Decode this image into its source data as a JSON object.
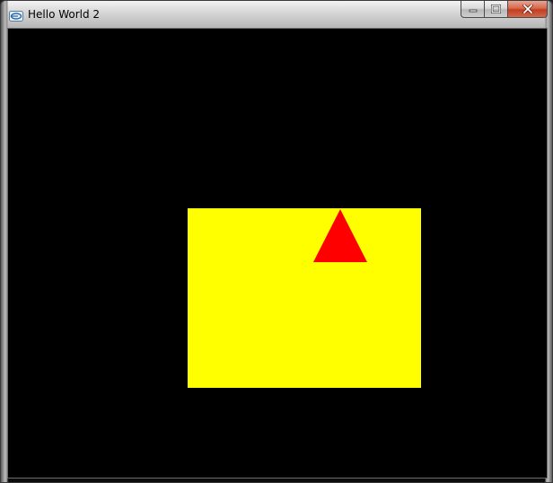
{
  "window": {
    "title": "Hello World 2",
    "caption_buttons": [
      {
        "name": "minimize",
        "icon": "minimize-icon"
      },
      {
        "name": "maximize",
        "icon": "maximize-icon"
      },
      {
        "name": "close",
        "icon": "close-icon"
      }
    ]
  },
  "scene": {
    "background_color": "#000000",
    "rectangle_color": "#ffff00",
    "triangle_color": "#ff0000"
  },
  "colors": {
    "close_button": "#c13e1f"
  }
}
